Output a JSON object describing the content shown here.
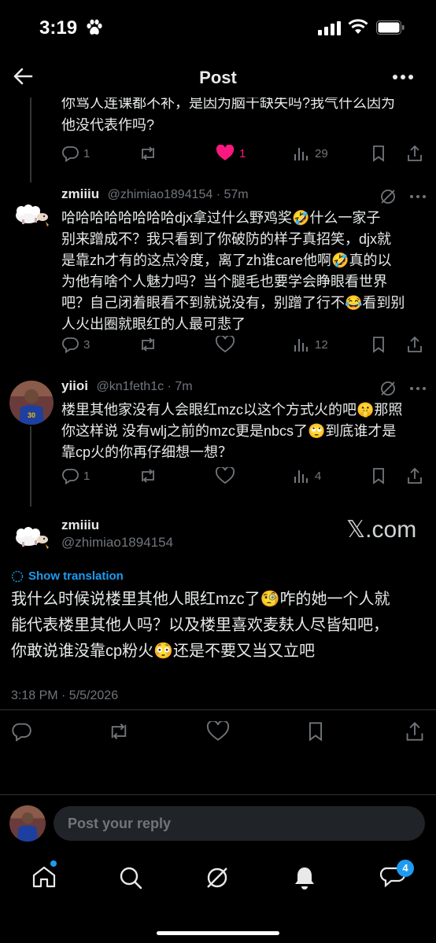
{
  "status": {
    "time": "3:19"
  },
  "header": {
    "title": "Post"
  },
  "top_comment": {
    "text_line1": "你骂人连课都不补，是因为脑干缺失吗?我气什么因为",
    "text_line2": "他没代表作吗?",
    "replies": "1",
    "likes": "1",
    "views": "29"
  },
  "comment1": {
    "name": "zmiiiu",
    "handle": "@zhimiao1894154 · 57m",
    "lines": [
      "哈哈哈哈哈哈哈哈djx拿过什么野鸡奖🤣什么一家子",
      "别来蹭成不？我只看到了你破防的样子真招笑，djx就",
      "是靠zh才有的这点冷度，离了zh谁care他啊🤣真的以",
      "为他有啥个人魅力吗？当个腿毛也要学会睁眼看世界",
      "吧？自己闭着眼看不到就说没有，别蹭了行不😂看到别",
      "人火出圈就眼红的人最可悲了"
    ],
    "replies": "3",
    "views": "12"
  },
  "comment2": {
    "name": "yiioi",
    "handle": "@kn1feth1c · 7m",
    "lines": [
      "楼里其他家没有人会眼红mzc以这个方式火的吧🤫那照",
      "你这样说 没有wlj之前的mzc更是nbcs了🙄到底谁才是",
      "靠cp火的你再仔细想一想？"
    ],
    "replies": "1",
    "views": "4"
  },
  "main_post": {
    "name": "zmiiiu",
    "handle": "@zhimiao1894154",
    "watermark": "𝕏.com",
    "show_translation": "Show translation",
    "lines": [
      "我什么时候说楼里其他人眼红mzc了🧐咋的她一个人就",
      "能代表楼里其他人吗？以及楼里喜欢麦麸人尽皆知吧，",
      "你敢说谁没靠cp粉火😳还是不要又当又立吧"
    ],
    "timestamp": "3:18 PM · 5/5/2026"
  },
  "reply": {
    "placeholder": "Post your reply"
  },
  "tabbar": {
    "messages_badge": "4"
  },
  "colors": {
    "accent": "#1d9bf0",
    "like": "#f91880",
    "muted": "#71767b"
  }
}
